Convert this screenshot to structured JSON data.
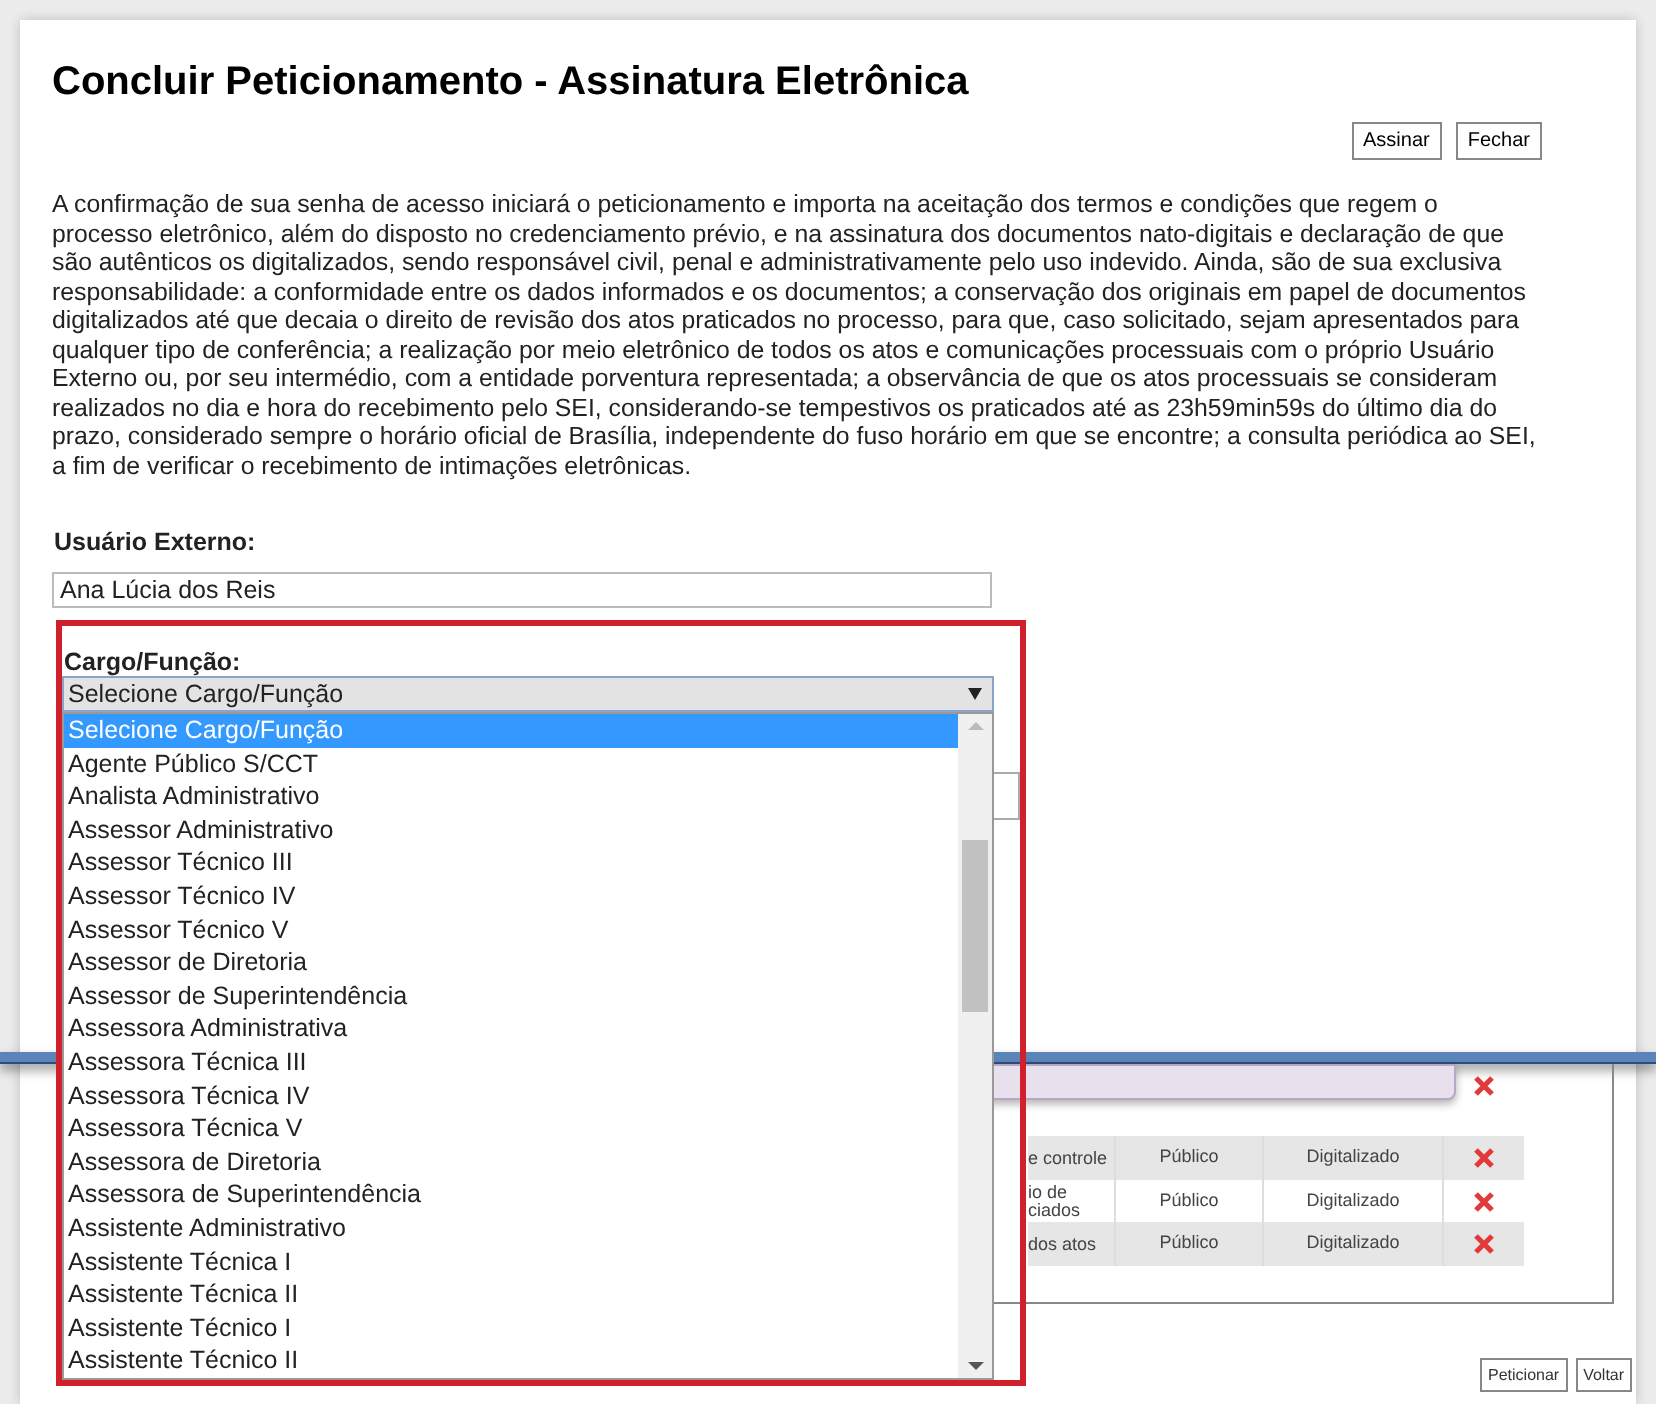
{
  "dialog": {
    "title": "Concluir Peticionamento - Assinatura Eletrônica",
    "buttons": [
      {
        "label": "Assinar"
      },
      {
        "label": "Fechar"
      }
    ],
    "notice": "A confirmação de sua senha de acesso iniciará o peticionamento e importa na aceitação dos termos e condições que regem o processo eletrônico, além do disposto no credenciamento prévio, e na assinatura dos documentos nato-digitais e declaração de que são autênticos os digitalizados, sendo responsável civil, penal e administrativamente pelo uso indevido. Ainda, são de sua exclusiva responsabilidade: a conformidade entre os dados informados e os documentos; a conservação dos originais em papel de documentos digitalizados até que decaia o direito de revisão dos atos praticados no processo, para que, caso solicitado, sejam apresentados para qualquer tipo de conferência; a realização por meio eletrônico de todos os atos e comunicações processuais com o próprio Usuário Externo ou, por seu intermédio, com a entidade porventura representada; a observância de que os atos processuais se consideram realizados no dia e hora do recebimento pelo SEI, considerando-se tempestivos os praticados até as 23h59min59s do último dia do prazo, considerado sempre o horário oficial de Brasília, independente do fuso horário em que se encontre; a consulta periódica ao SEI, a fim de verificar o recebimento de intimações eletrônicas.",
    "external_user": {
      "label": "Usuário Externo:",
      "value": "Ana Lúcia dos Reis"
    },
    "role": {
      "label": "Cargo/Função:",
      "value": "Selecione Cargo/Função",
      "expanded": true,
      "options": [
        {
          "label": "Selecione Cargo/Função",
          "selected": true
        },
        {
          "label": "Agente Público S/CCT",
          "selected": false
        },
        {
          "label": "Analista Administrativo",
          "selected": false
        },
        {
          "label": "Assessor Administrativo",
          "selected": false
        },
        {
          "label": "Assessor Técnico III",
          "selected": false
        },
        {
          "label": "Assessor Técnico IV",
          "selected": false
        },
        {
          "label": "Assessor Técnico V",
          "selected": false
        },
        {
          "label": "Assessor de Diretoria",
          "selected": false
        },
        {
          "label": "Assessor de Superintendência",
          "selected": false
        },
        {
          "label": "Assessora Administrativa",
          "selected": false
        },
        {
          "label": "Assessora Técnica III",
          "selected": false
        },
        {
          "label": "Assessora Técnica IV",
          "selected": false
        },
        {
          "label": "Assessora Técnica V",
          "selected": false
        },
        {
          "label": "Assessora de Diretoria",
          "selected": false
        },
        {
          "label": "Assessora de Superintendência",
          "selected": false
        },
        {
          "label": "Assistente Administrativo",
          "selected": false
        },
        {
          "label": "Assistente Técnica I",
          "selected": false
        },
        {
          "label": "Assistente Técnica II",
          "selected": false
        },
        {
          "label": "Assistente Técnico I",
          "selected": false
        },
        {
          "label": "Assistente Técnico II",
          "selected": false
        }
      ]
    }
  },
  "documents_table": {
    "rows": [
      {
        "kind": "covered"
      },
      {
        "kind": "full",
        "document": "e controle",
        "access": "Público",
        "format": "Digitalizado"
      },
      {
        "kind": "full",
        "document": "io de\nciados",
        "access": "Público",
        "format": "Digitalizado"
      },
      {
        "kind": "full",
        "document": "dos atos",
        "access": "Público",
        "format": "Digitalizado"
      }
    ]
  },
  "footer_buttons": [
    {
      "label": "Peticionar"
    },
    {
      "label": "Voltar"
    }
  ]
}
